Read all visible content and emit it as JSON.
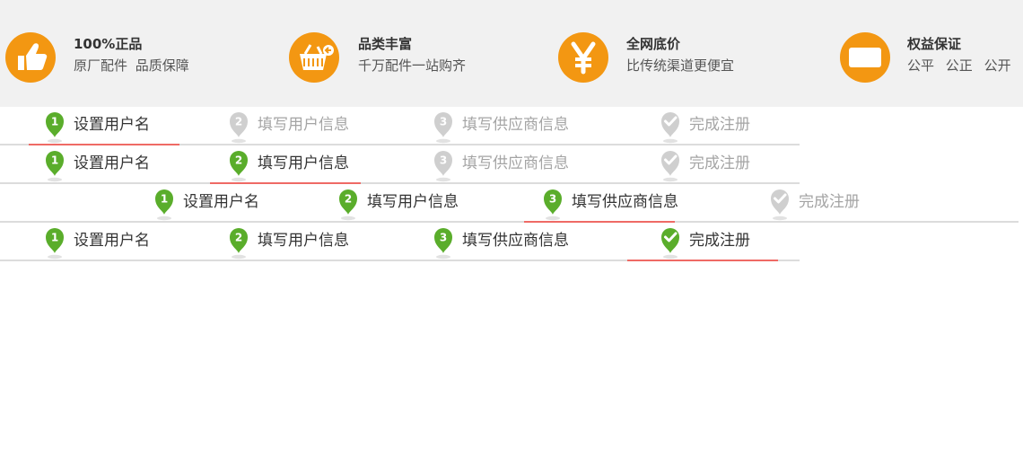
{
  "features": [
    {
      "title": "100%正品",
      "subtitle": [
        "原厂配件",
        "品质保障"
      ],
      "icon": "thumbs-up-icon"
    },
    {
      "title": "品类丰富",
      "subtitle": [
        "千万配件一站购齐"
      ],
      "icon": "shopping-basket-icon"
    },
    {
      "title": "全网底价",
      "subtitle": [
        "比传统渠道更便宜"
      ],
      "icon": "yen-icon"
    },
    {
      "title": "权益保证",
      "subtitle": [
        "公平",
        "公正",
        "公开"
      ],
      "icon": "card-icon"
    }
  ],
  "steps": {
    "labels": [
      "设置用户名",
      "填写用户信息",
      "填写供应商信息",
      "完成注册"
    ],
    "numbers": [
      "1",
      "2",
      "3"
    ],
    "rows": [
      {
        "current_step": 1
      },
      {
        "current_step": 2
      },
      {
        "current_step": 3
      },
      {
        "current_step": 4
      }
    ]
  },
  "colors": {
    "accent": "#f39712",
    "done_green": "#5aad2b",
    "todo_gray": "#cfcfcf",
    "active_underline": "#ef6a65",
    "banner_bg": "#f1f1f1"
  }
}
